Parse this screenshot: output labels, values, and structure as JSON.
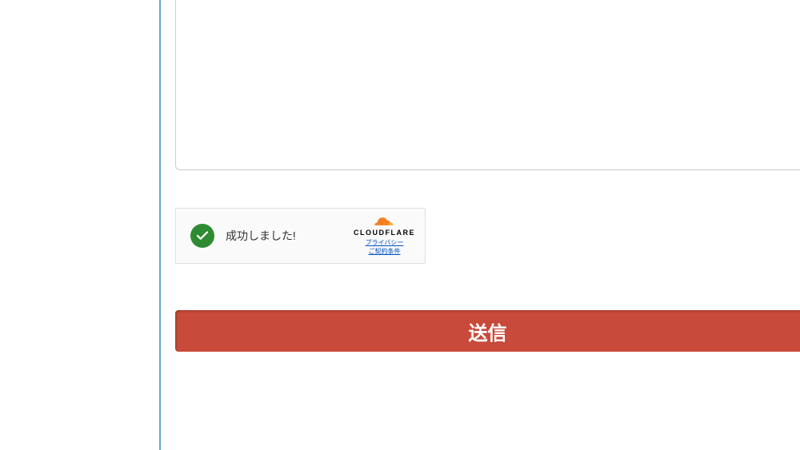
{
  "captcha": {
    "success_text": "成功しました!",
    "brand": "CLOUDFLARE",
    "privacy_link": "プライバシー",
    "terms_link": "ご契約条件"
  },
  "form": {
    "submit_label": "送信"
  }
}
